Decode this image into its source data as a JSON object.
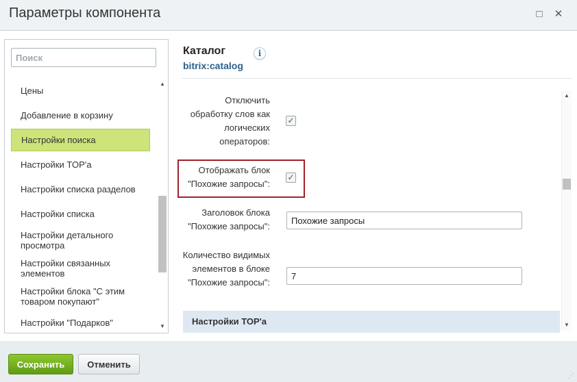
{
  "window": {
    "title": "Параметры компонента",
    "maximize_glyph": "□",
    "close_glyph": "✕"
  },
  "sidebar": {
    "search_placeholder": "Поиск",
    "items": [
      {
        "label": "Цены"
      },
      {
        "label": "Добавление в корзину"
      },
      {
        "label": "Настройки поиска",
        "active": true
      },
      {
        "label": "Настройки TOP'а"
      },
      {
        "label": "Настройки списка разделов"
      },
      {
        "label": "Настройки списка"
      },
      {
        "label": "Настройки детального просмотра"
      },
      {
        "label": "Настройки связанных элементов"
      },
      {
        "label": "Настройки блока \"С этим товаром покупают\""
      },
      {
        "label": "Настройки \"Подарков\""
      }
    ]
  },
  "component": {
    "title": "Каталог",
    "code": "bitrix:catalog",
    "info_glyph": "i"
  },
  "settings": {
    "disable_logic": {
      "label": "Отключить обработку слов как логических операторов:",
      "checked": true
    },
    "show_similar": {
      "label": "Отображать блок \"Похожие запросы\":",
      "checked": true
    },
    "similar_title": {
      "label": "Заголовок блока \"Похожие запросы\":",
      "value": "Похожие запросы"
    },
    "similar_count": {
      "label": "Количество видимых элементов в блоке \"Похожие запросы\":",
      "value": "7"
    },
    "next_section": "Настройки TOP'а"
  },
  "footer": {
    "save_label": "Сохранить",
    "cancel_label": "Отменить"
  }
}
